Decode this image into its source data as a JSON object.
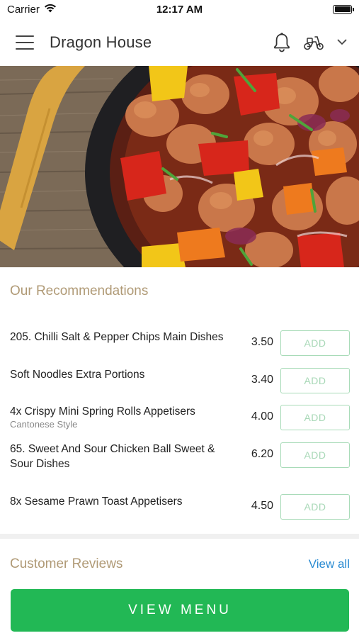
{
  "status_bar": {
    "carrier": "Carrier",
    "time": "12:17 AM",
    "wifi_icon": "wifi-icon",
    "battery_level": 1.0
  },
  "header": {
    "title": "Dragon House",
    "menu_icon": "hamburger-menu-icon",
    "bell_icon": "bell-icon",
    "delivery_icon": "scooter-icon",
    "dropdown_icon": "chevron-down-icon"
  },
  "hero": {
    "image": "food-dish-photo"
  },
  "recommendations": {
    "title": "Our Recommendations",
    "items": [
      {
        "name": "205. Chilli Salt & Pepper Chips Main Dishes",
        "subtitle": "",
        "price": "3.50",
        "button": "ADD"
      },
      {
        "name": "Soft Noodles Extra Portions",
        "subtitle": "",
        "price": "3.40",
        "button": "ADD"
      },
      {
        "name": "4x Crispy Mini Spring Rolls Appetisers",
        "subtitle": "Cantonese Style",
        "price": "4.00",
        "button": "ADD"
      },
      {
        "name": "65. Sweet And Sour Chicken Ball Sweet & Sour Dishes",
        "subtitle": "",
        "price": "6.20",
        "button": "ADD"
      },
      {
        "name": "8x Sesame Prawn Toast Appetisers",
        "subtitle": "",
        "price": "4.50",
        "button": "ADD"
      }
    ]
  },
  "reviews": {
    "title": "Customer Reviews",
    "view_all": "View all"
  },
  "footer": {
    "view_menu": "VIEW MENU"
  },
  "colors": {
    "accent_gold": "#b09a76",
    "primary_green": "#22b855",
    "add_outline": "#a8dbb8",
    "link_blue": "#2a8bd2"
  }
}
